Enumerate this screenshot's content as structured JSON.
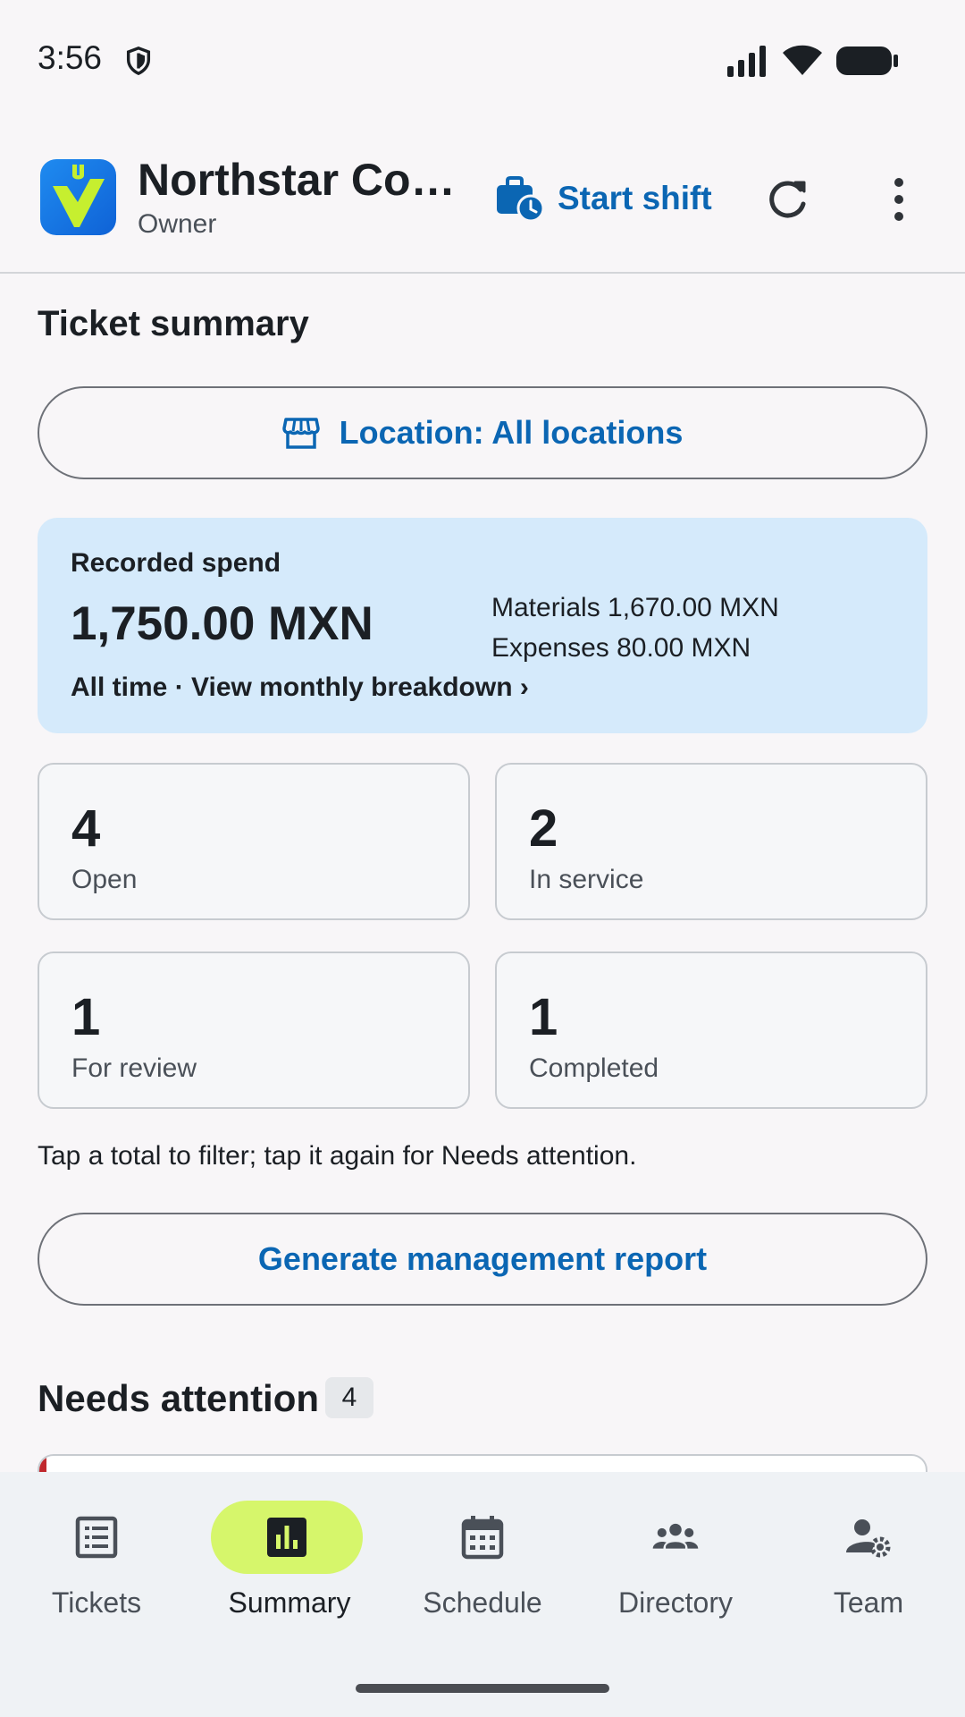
{
  "status_bar": {
    "time": "3:56",
    "icons": [
      "shield-icon",
      "signal-icon",
      "wifi-icon",
      "battery-icon"
    ]
  },
  "app_bar": {
    "title": "Northstar Co…",
    "subtitle": "Owner",
    "start_shift_label": "Start shift",
    "icons": [
      "app-logo",
      "briefcase-clock-icon",
      "refresh-icon",
      "more-vert-icon"
    ]
  },
  "summary": {
    "section_title": "Ticket summary",
    "location_button": "Location: All locations",
    "spend": {
      "label": "Recorded spend",
      "total": "1,750.00 MXN",
      "materials": "Materials 1,670.00 MXN",
      "expenses": "Expenses 80.00 MXN",
      "link": "All time · View monthly breakdown ›"
    },
    "stats": [
      {
        "count": "4",
        "label": "Open"
      },
      {
        "count": "2",
        "label": "In service"
      },
      {
        "count": "1",
        "label": "For review"
      },
      {
        "count": "1",
        "label": "Completed"
      }
    ],
    "hint": "Tap a total to filter; tap it again for Needs attention.",
    "report_button": "Generate management report"
  },
  "needs_attention": {
    "title": "Needs attention",
    "count": "4"
  },
  "bottom_nav": {
    "items": [
      {
        "label": "Tickets",
        "icon": "tickets-icon",
        "active": false
      },
      {
        "label": "Summary",
        "icon": "bar-chart-icon",
        "active": true
      },
      {
        "label": "Schedule",
        "icon": "calendar-icon",
        "active": false
      },
      {
        "label": "Directory",
        "icon": "people-icon",
        "active": false
      },
      {
        "label": "Team",
        "icon": "person-gear-icon",
        "active": false
      }
    ]
  },
  "colors": {
    "accent": "#0b66b3",
    "spend_card_bg": "#d5eafb",
    "active_nav_pill": "#d6f66b",
    "attention_stripe": "#c0282d"
  }
}
